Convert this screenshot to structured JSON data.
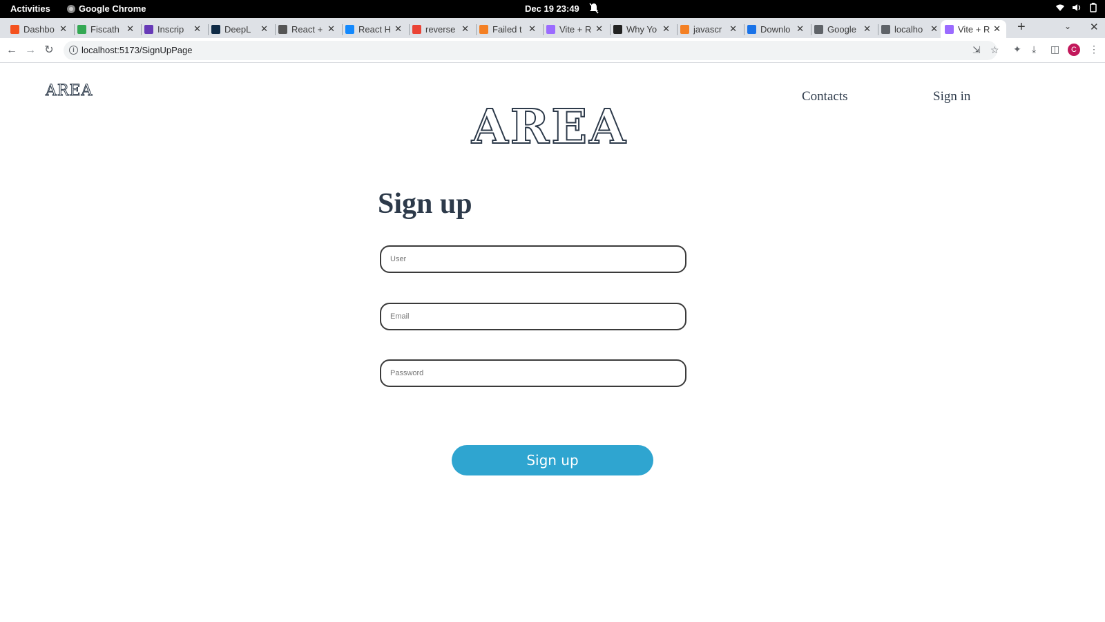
{
  "system_bar": {
    "activities": "Activities",
    "app_name": "Google Chrome",
    "clock": "Dec 19  23:49"
  },
  "browser": {
    "tabs": [
      {
        "label": "Dashbo",
        "icon": "dashboard-icon",
        "color": "#f4511e"
      },
      {
        "label": "Fiscath",
        "icon": "fiscath-icon",
        "color": "#34a853"
      },
      {
        "label": "Inscrip",
        "icon": "form-icon",
        "color": "#673ab7"
      },
      {
        "label": "DeepL",
        "icon": "deepl-icon",
        "color": "#0f2b46"
      },
      {
        "label": "React +",
        "icon": "github-icon",
        "color": "#555555"
      },
      {
        "label": "React H",
        "icon": "stackblitz-icon",
        "color": "#1389fd"
      },
      {
        "label": "reverse",
        "icon": "google-icon",
        "color": "#ea4335"
      },
      {
        "label": "Failed t",
        "icon": "stackoverflow-icon",
        "color": "#f48024"
      },
      {
        "label": "Vite + R",
        "icon": "vite-icon",
        "color": "#9b6bff"
      },
      {
        "label": "Why Yo",
        "icon": "medium-icon",
        "color": "#222222"
      },
      {
        "label": "javascr",
        "icon": "stackoverflow-icon",
        "color": "#f48024"
      },
      {
        "label": "Downlo",
        "icon": "download-icon",
        "color": "#1a73e8"
      },
      {
        "label": "Google",
        "icon": "key-icon",
        "color": "#5f6368"
      },
      {
        "label": "localho",
        "icon": "globe-icon",
        "color": "#5f6368"
      },
      {
        "label": "Vite + R",
        "icon": "vite-icon",
        "color": "#9b6bff",
        "active": true
      }
    ],
    "url": "localhost:5173/SignUpPage"
  },
  "page": {
    "logo_small": "AREA",
    "nav": {
      "contacts": "Contacts",
      "sign_in": "Sign in"
    },
    "logo_big": "AREA",
    "title": "Sign up",
    "fields": {
      "user_placeholder": "User",
      "email_placeholder": "Email",
      "password_placeholder": "Password"
    },
    "submit_label": "Sign up",
    "accent_color": "#2fa5d0"
  },
  "profile_initial": "C"
}
